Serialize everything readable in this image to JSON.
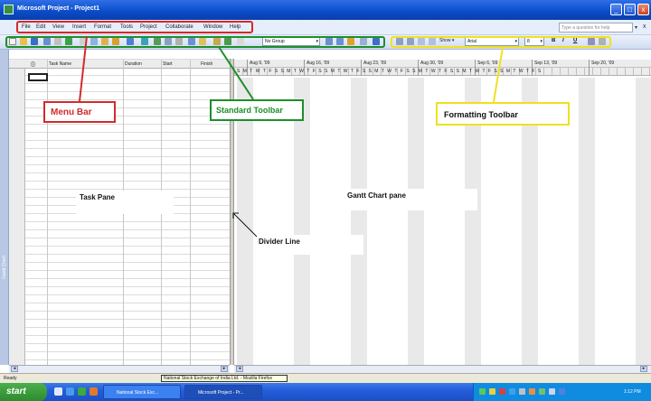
{
  "window": {
    "title": "Microsoft Project - Project1",
    "minimize": "_",
    "maximize": "□",
    "close": "x"
  },
  "menubar": {
    "items": [
      {
        "label": "File"
      },
      {
        "label": "Edit"
      },
      {
        "label": "View"
      },
      {
        "label": "Insert"
      },
      {
        "label": "Format"
      },
      {
        "label": "Tools"
      },
      {
        "label": "Project"
      },
      {
        "label": "Collaborate"
      },
      {
        "label": "Window"
      },
      {
        "label": "Help"
      }
    ],
    "ask_placeholder": "Type a question for help",
    "doc_close": "x"
  },
  "standard_toolbar": {
    "group_value": "No Group"
  },
  "formatting_toolbar": {
    "show_label": "Show ▾",
    "font_value": "Arial",
    "size_value": "8",
    "bold": "B",
    "italic": "I",
    "underline": "U"
  },
  "task_table": {
    "columns": [
      {
        "label": "Task Name"
      },
      {
        "label": "Duration"
      },
      {
        "label": "Start"
      },
      {
        "label": "Finish"
      }
    ],
    "info_icon": "ⓘ"
  },
  "gantt": {
    "weeks": [
      "Aug 9, '09",
      "Aug 16, '09",
      "Aug 23, '09",
      "Aug 30, '09",
      "Sep 6, '09",
      "Sep 13, '09",
      "Sep 20, '09"
    ],
    "days_row": "SMTWTFSSMTWTFSSMTWTFSSMTWTFSSMTWTFSSMTWTFSSMTWTFS"
  },
  "viewbar": {
    "label": "Gantt Chart"
  },
  "status": {
    "ready": "Ready",
    "tooltip": "National Stock Exchange of India Ltd. - Mozilla Firefox"
  },
  "taskbar": {
    "start": "start",
    "buttons": [
      {
        "label": "National Stock Exc..."
      },
      {
        "label": "Microsoft Project - Pr..."
      }
    ],
    "clock": "1:12 PM"
  },
  "annotations": {
    "menu_bar": "Menu Bar",
    "standard_toolbar": "Standard Toolbar",
    "formatting_toolbar": "Formatting Toolbar",
    "task_pane": "Task Pane",
    "gantt_pane": "Gantt Chart pane",
    "divider_line": "Divider Line"
  },
  "colors": {
    "menu_annotation": "#d42a2a",
    "standard_annotation": "#1d8f2a",
    "formatting_annotation": "#f0e020",
    "titlebar": "#0a4bc9"
  }
}
